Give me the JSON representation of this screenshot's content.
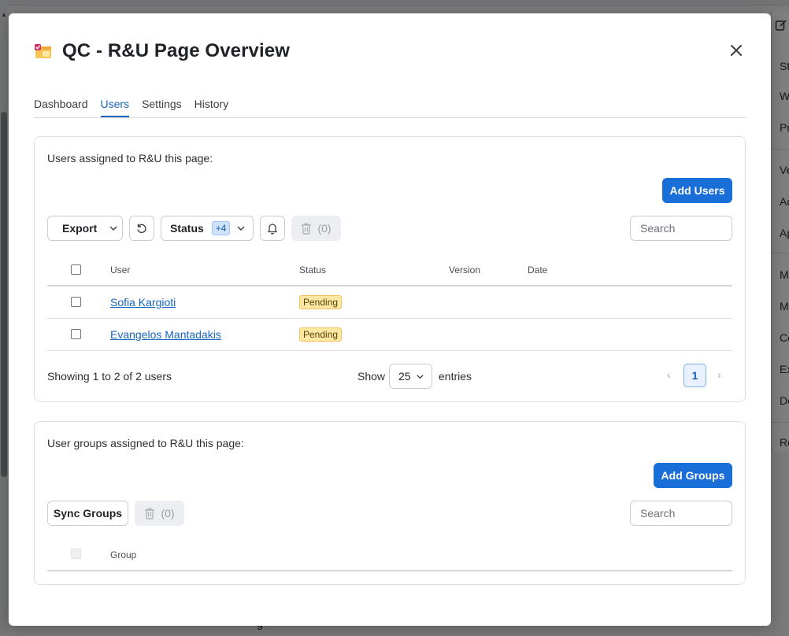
{
  "background": {
    "menu_items": [
      "St",
      "W",
      "Pr",
      "Ve",
      "Ad",
      "Ap",
      "M",
      "M",
      "Co",
      "Ex",
      "De",
      "Re"
    ],
    "bottom_fragment_right": "n",
    "bottom_fragment_left": "g"
  },
  "modal": {
    "title": "QC - R&U Page Overview",
    "app_icon": "calendar-check-icon",
    "close_icon": "close-icon"
  },
  "tabs": [
    {
      "label": "Dashboard",
      "active": false
    },
    {
      "label": "Users",
      "active": true
    },
    {
      "label": "Settings",
      "active": false
    },
    {
      "label": "History",
      "active": false
    }
  ],
  "users_section": {
    "heading": "Users assigned to R&U this page:",
    "add_button": "Add Users",
    "export_label": "Export",
    "status_label": "Status",
    "status_badge": "+4",
    "delete_count": "(0)",
    "search_placeholder": "Search",
    "columns": [
      "User",
      "Status",
      "Version",
      "Date"
    ],
    "rows": [
      {
        "user": "Sofia Kargioti",
        "status": "Pending",
        "version": "",
        "date": ""
      },
      {
        "user": "Evangelos Mantadakis",
        "status": "Pending",
        "version": "",
        "date": ""
      }
    ],
    "footer": {
      "showing": "Showing 1 to 2 of 2 users",
      "show_label": "Show",
      "page_size": "25",
      "entries_label": "entries",
      "current_page": "1",
      "prev_arrow": "‹",
      "next_arrow": "›"
    }
  },
  "groups_section": {
    "heading": "User groups assigned to R&U this page:",
    "add_button": "Add Groups",
    "sync_label": "Sync Groups",
    "delete_count": "(0)",
    "search_placeholder": "Search",
    "columns": [
      "Group"
    ]
  },
  "colors": {
    "primary": "#1a6ed8",
    "link": "#1565c0",
    "pending_bg": "#fde7a4",
    "badge_bg": "#cfe2fb"
  }
}
